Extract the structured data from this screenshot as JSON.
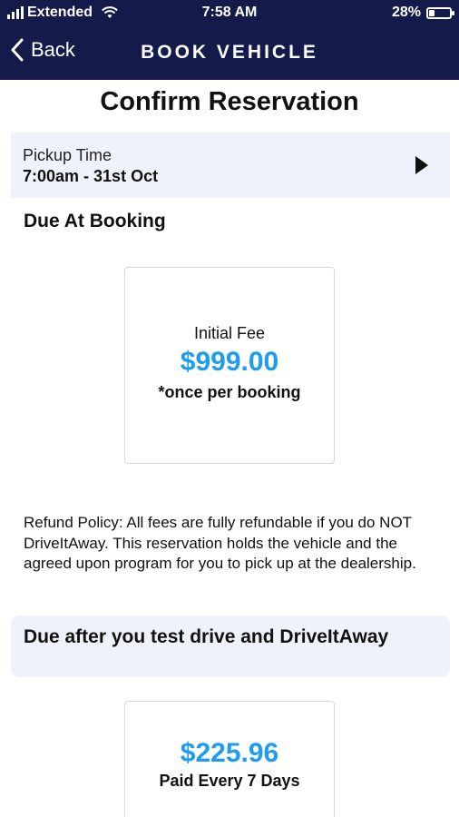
{
  "status_bar": {
    "carrier": "Extended",
    "time": "7:58 AM",
    "battery_percent_label": "28%",
    "battery_level": 0.28
  },
  "nav": {
    "back_label": "Back",
    "title": "BOOK VEHICLE"
  },
  "page": {
    "title": "Confirm Reservation"
  },
  "pickup": {
    "label": "Pickup Time",
    "value": "7:00am - 31st Oct"
  },
  "due_at_booking": {
    "heading": "Due At Booking",
    "fee_label": "Initial Fee",
    "fee_amount": "$999.00",
    "fee_note": "*once per booking"
  },
  "refund_policy": {
    "text": "Refund Policy: All fees are fully refundable if you do NOT DriveItAway. This reservation holds the vehicle and the agreed upon program for you to pick up at the dealership."
  },
  "due_after": {
    "heading": "Due after you test drive and DriveItAway",
    "amount": "$225.96",
    "frequency": "Paid Every 7 Days"
  },
  "colors": {
    "header_bg": "#141a4a",
    "accent_blue": "#1e9cf0",
    "panel_bg": "#eef3fb"
  }
}
